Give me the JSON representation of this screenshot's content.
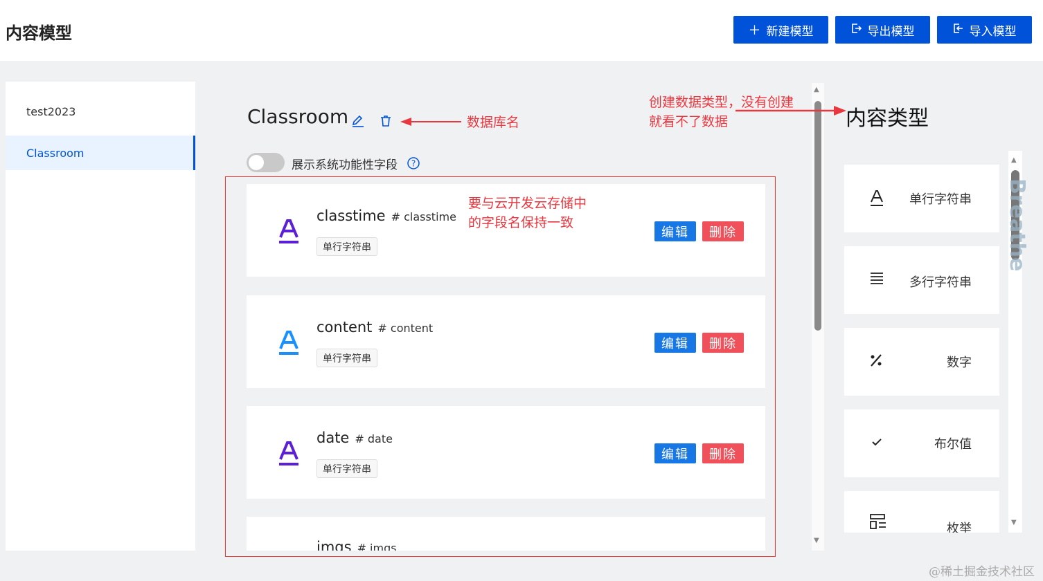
{
  "header": {
    "title": "内容模型",
    "buttons": {
      "new_model": "新建模型",
      "export_model": "导出模型",
      "import_model": "导入模型"
    }
  },
  "sidebar": {
    "items": [
      {
        "label": "test2023",
        "active": false
      },
      {
        "label": "Classroom",
        "active": true
      }
    ]
  },
  "main": {
    "model_title": "Classroom",
    "toggle_label": "展示系统功能性字段",
    "toggle_on": false,
    "fields": [
      {
        "name": "classtime",
        "key": "# classtime",
        "tag": "单行字符串",
        "icon": "text-a-icon",
        "icon_color": "#5b1fd6"
      },
      {
        "name": "content",
        "key": "# content",
        "tag": "单行字符串",
        "icon": "text-a-icon",
        "icon_color": "#1890ff"
      },
      {
        "name": "date",
        "key": "# date",
        "tag": "单行字符串",
        "icon": "text-a-icon",
        "icon_color": "#5b1fd6"
      },
      {
        "name": "imgs",
        "key": "# imgs",
        "tag": "",
        "icon": "list-icon",
        "icon_color": "#1890ff"
      }
    ],
    "edit_label": "编辑",
    "delete_label": "删除"
  },
  "content_types": {
    "title": "内容类型",
    "items": [
      {
        "label": "单行字符串",
        "icon": "single-line-text-icon"
      },
      {
        "label": "多行字符串",
        "icon": "multi-line-text-icon"
      },
      {
        "label": "数字",
        "icon": "percent-number-icon"
      },
      {
        "label": "布尔值",
        "icon": "check-boolean-icon"
      },
      {
        "label": "枚举",
        "icon": "enum-icon"
      }
    ],
    "overlay_text": "Breathe"
  },
  "annotations": {
    "db_name": "数据库名",
    "create_type_line1": "创建数据类型，没有创建",
    "create_type_line2": "就看不了数据",
    "field_name_line1": "要与云开发云存储中",
    "field_name_line2": "的字段名保持一致"
  },
  "watermark": "@稀土掘金技术社区",
  "colors": {
    "primary": "#0052d9",
    "edit": "#1677e5",
    "delete": "#f0505a",
    "annotation": "#e8373f"
  }
}
